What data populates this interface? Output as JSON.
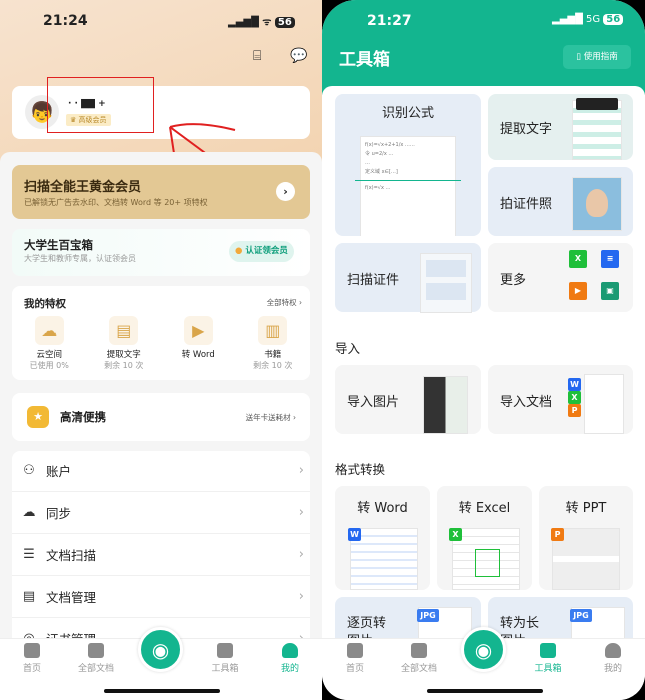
{
  "left": {
    "status": {
      "time": "21:24",
      "battery": "56"
    },
    "profile": {
      "name": "· ·  ▇▇ +",
      "member_badge": "高级会员"
    },
    "gold": {
      "title": "扫描全能王黄金会员",
      "subtitle": "已解锁无广告去水印、文档转 Word 等 20+ 项特权"
    },
    "student": {
      "title": "大学生百宝箱",
      "subtitle": "大学生和教师专属，认证领会员",
      "button": "认证领会员"
    },
    "privileges": {
      "title": "我的特权",
      "all": "全部特权 ›",
      "items": [
        {
          "label": "云空间",
          "sub": "已使用 0%",
          "icon": "cloud-upload-icon"
        },
        {
          "label": "提取文字",
          "sub": "剩余 10 次",
          "icon": "text-extract-icon"
        },
        {
          "label": "转 Word",
          "sub": "",
          "icon": "word-convert-icon"
        },
        {
          "label": "书籍",
          "sub": "剩余 10 次",
          "icon": "book-icon"
        }
      ]
    },
    "hd": {
      "title": "高清便携",
      "link": "送年卡送耗材 ›"
    },
    "menu": [
      {
        "label": "账户",
        "icon": "user-icon"
      },
      {
        "label": "同步",
        "icon": "cloud-sync-icon"
      },
      {
        "label": "文档扫描",
        "icon": "scan-icon"
      },
      {
        "label": "文档管理",
        "icon": "document-icon"
      },
      {
        "label": "证书管理",
        "icon": "certificate-icon"
      }
    ],
    "tabs": [
      "首页",
      "全部文档",
      "工具箱",
      "我的"
    ]
  },
  "right": {
    "status": {
      "time": "21:27",
      "network": "5G",
      "battery": "56"
    },
    "title": "工具箱",
    "guide": "使用指南",
    "tools": [
      "识别公式",
      "提取文字",
      "拍证件照",
      "扫描证件",
      "更多"
    ],
    "import": {
      "title": "导入",
      "items": [
        "导入图片",
        "导入文档"
      ]
    },
    "convert": {
      "title": "格式转换",
      "items": [
        "转 Word",
        "转 Excel",
        "转 PPT",
        "逐页转图片",
        "转为长图片"
      ]
    },
    "tabs": [
      "首页",
      "全部文档",
      "工具箱",
      "我的"
    ]
  },
  "colors": {
    "brand": "#13b58f",
    "gold": "#e3c894",
    "annotation": "#e02020"
  }
}
